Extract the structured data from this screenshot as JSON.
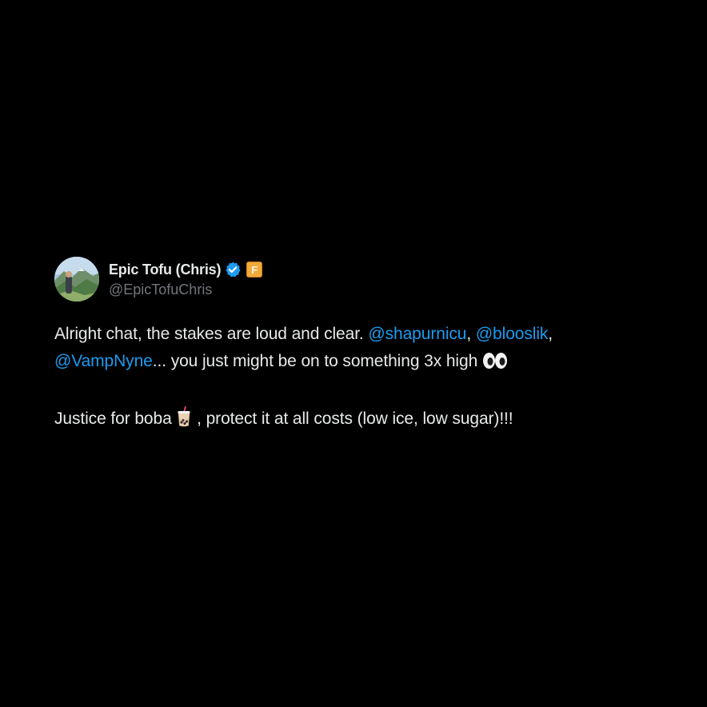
{
  "tweet": {
    "author": {
      "display_name": "Epic Tofu (Chris)",
      "handle": "@EpicTofuChris",
      "verified_icon": "verified-check-icon",
      "affiliate_badge": {
        "icon": "affiliate-badge-icon",
        "letter": "F",
        "color": "#f2a93b"
      }
    },
    "line1": {
      "text_before": "Alright chat, the stakes are loud and clear. ",
      "mention1": "@shapurnicu",
      "sep1": ", ",
      "mention2": "@blooslik",
      "sep2": ","
    },
    "line2": {
      "mention3": "@VampNyne",
      "text_after": "... you just might be on to something 3x high ",
      "emoji": "eyes-emoji"
    },
    "line3": {
      "text_before": "Justice for boba ",
      "emoji": "bubble-tea-emoji",
      "text_after": " , protect it at all costs (low ice, low sugar)!!!"
    }
  },
  "colors": {
    "background": "#000000",
    "text": "#e7e9ea",
    "secondary_text": "#71767b",
    "link": "#1d9bf0",
    "verified": "#1d9bf0"
  }
}
